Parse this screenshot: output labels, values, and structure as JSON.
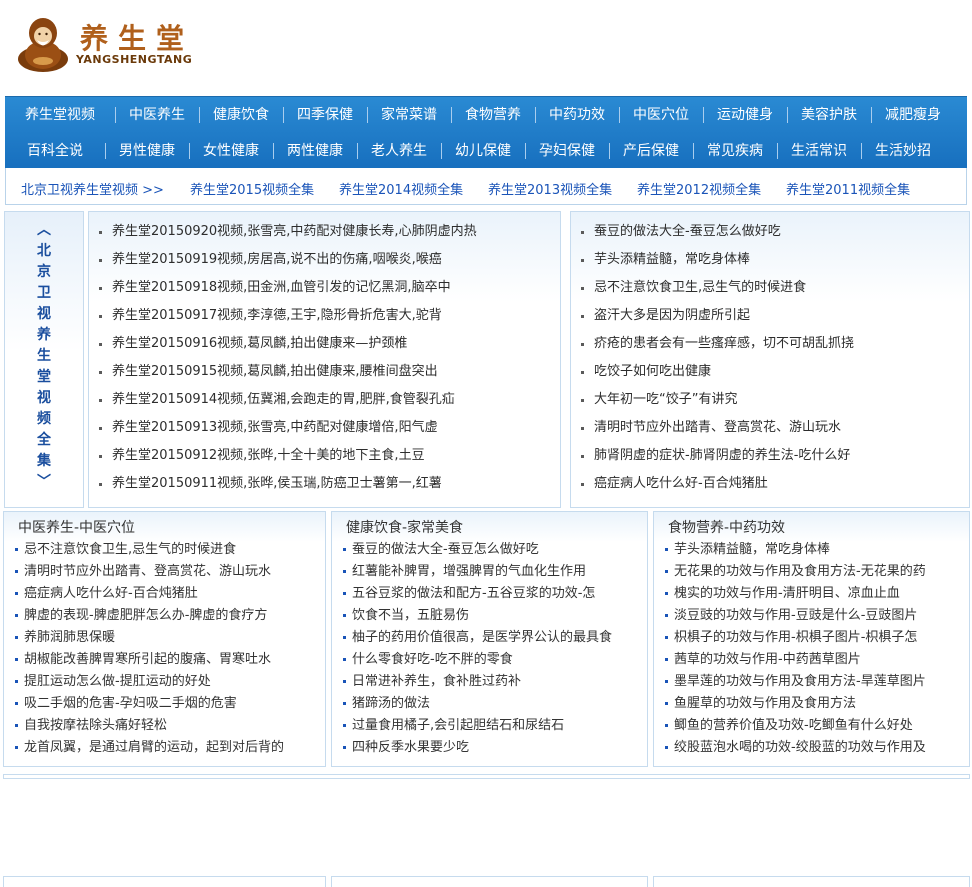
{
  "logo": {
    "title": "养生堂",
    "subtitle": "YANGSHENGTANG"
  },
  "nav": {
    "row1": [
      "养生堂视频",
      "中医养生",
      "健康饮食",
      "四季保健",
      "家常菜谱",
      "食物营养",
      "中药功效",
      "中医穴位",
      "运动健身",
      "美容护肤",
      "减肥瘦身"
    ],
    "row2": [
      "百科全说",
      "男性健康",
      "女性健康",
      "两性健康",
      "老人养生",
      "幼儿保健",
      "孕妇保健",
      "产后保健",
      "常见疾病",
      "生活常识",
      "生活妙招"
    ]
  },
  "subbar": {
    "first": "北京卫视养生堂视频 >>",
    "links": [
      "养生堂2015视频全集",
      "养生堂2014视频全集",
      "养生堂2013视频全集",
      "养生堂2012视频全集",
      "养生堂2011视频全集"
    ]
  },
  "video_tab": {
    "label": "︿北京卫视养生堂视频全集﹀"
  },
  "video_list": [
    "养生堂20150920视频,张雪亮,中药配对健康长寿,心肺阴虚内热",
    "养生堂20150919视频,房居高,说不出的伤痛,咽喉炎,喉癌",
    "养生堂20150918视频,田金洲,血管引发的记忆黑洞,脑卒中",
    "养生堂20150917视频,李淳德,王宇,隐形骨折危害大,驼背",
    "养生堂20150916视频,葛凤麟,拍出健康来—护颈椎",
    "养生堂20150915视频,葛凤麟,拍出健康来,腰椎间盘突出",
    "养生堂20150914视频,伍冀湘,会跑走的胃,肥胖,食管裂孔疝",
    "养生堂20150913视频,张雪亮,中药配对健康增倍,阳气虚",
    "养生堂20150912视频,张晔,十全十美的地下主食,土豆",
    "养生堂20150911视频,张晔,侯玉瑞,防癌卫士薯第一,红薯"
  ],
  "side_list": [
    "蚕豆的做法大全-蚕豆怎么做好吃",
    "芋头添精益髓，常吃身体棒",
    "忌不注意饮食卫生,忌生气的时候进食",
    "盗汗大多是因为阴虚所引起",
    "疥疮的患者会有一些瘙痒感，切不可胡乱抓挠",
    "吃饺子如何吃出健康",
    "大年初一吃“饺子”有讲究",
    "清明时节应外出踏青、登高赏花、游山玩水",
    "肺肾阴虚的症状-肺肾阴虚的养生法-吃什么好",
    "癌症病人吃什么好-百合炖猪肚"
  ],
  "categories": [
    {
      "title": "中医养生-中医穴位",
      "items": [
        "忌不注意饮食卫生,忌生气的时候进食",
        "清明时节应外出踏青、登高赏花、游山玩水",
        "癌症病人吃什么好-百合炖猪肚",
        "脾虚的表现-脾虚肥胖怎么办-脾虚的食疗方",
        "养肺润肺思保暖",
        "胡椒能改善脾胃寒所引起的腹痛、胃寒吐水",
        "提肛运动怎么做-提肛运动的好处",
        "吸二手烟的危害-孕妇吸二手烟的危害",
        "自我按摩祛除头痛好轻松",
        "龙首凤翼，是通过肩臂的运动，起到对后背的"
      ]
    },
    {
      "title": "健康饮食-家常美食",
      "items": [
        "蚕豆的做法大全-蚕豆怎么做好吃",
        "红薯能补脾胃，增强脾胃的气血化生作用",
        "五谷豆浆的做法和配方-五谷豆浆的功效-怎",
        "饮食不当，五脏易伤",
        "柚子的药用价值很高，是医学界公认的最具食",
        "什么零食好吃-吃不胖的零食",
        "日常进补养生，食补胜过药补",
        "猪蹄汤的做法",
        "过量食用橘子,会引起胆结石和尿结石",
        "四种反季水果要少吃"
      ]
    },
    {
      "title": "食物营养-中药功效",
      "items": [
        "芋头添精益髓，常吃身体棒",
        "无花果的功效与作用及食用方法-无花果的药",
        "槐实的功效与作用-清肝明目、凉血止血",
        "淡豆豉的功效与作用-豆豉是什么-豆豉图片",
        "枳椇子的功效与作用-枳椇子图片-枳椇子怎",
        "茜草的功效与作用-中药茜草图片",
        "墨旱莲的功效与作用及食用方法-旱莲草图片",
        "鱼腥草的功效与作用及食用方法",
        "鲫鱼的营养价值及功效-吃鲫鱼有什么好处",
        "绞股蓝泡水喝的功效-绞股蓝的功效与作用及"
      ]
    }
  ],
  "colors": {
    "nav_bg": "#1f7ccb",
    "link_blue": "#1a54b8",
    "logo_brown": "#b0601c",
    "border": "#c6dbee"
  },
  "icons": {
    "logo": "meditating-monk-icon",
    "bullet": "square-bullet-icon"
  }
}
